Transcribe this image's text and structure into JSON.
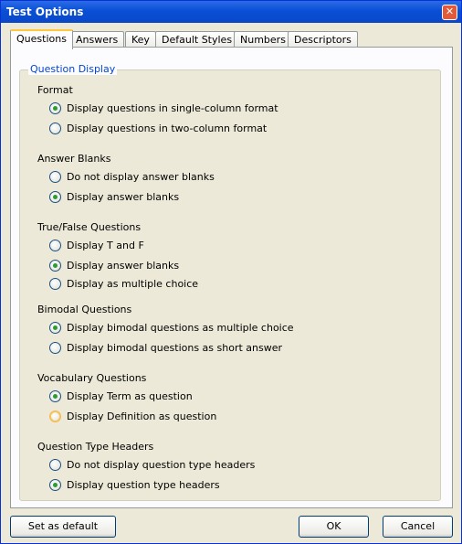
{
  "window": {
    "title": "Test Options",
    "close_glyph": "✕"
  },
  "tabs": [
    {
      "label": "Questions",
      "active": true
    },
    {
      "label": "Answers"
    },
    {
      "label": "Key"
    },
    {
      "label": "Default Styles"
    },
    {
      "label": "Numbers"
    },
    {
      "label": "Descriptors"
    }
  ],
  "group": {
    "legend": "Question Display",
    "sections": [
      {
        "label": "Format",
        "options": [
          {
            "label": "Display questions in single-column format",
            "checked": true
          },
          {
            "label": "Display questions in two-column format",
            "checked": false
          }
        ]
      },
      {
        "label": "Answer Blanks",
        "options": [
          {
            "label": "Do not display answer blanks",
            "checked": false
          },
          {
            "label": "Display answer blanks",
            "checked": true
          }
        ]
      },
      {
        "label": "True/False Questions",
        "options": [
          {
            "label": "Display T and F",
            "checked": false
          },
          {
            "label": "Display answer blanks",
            "checked": true
          },
          {
            "label": "Display as multiple choice",
            "checked": false
          }
        ]
      },
      {
        "label": "Bimodal Questions",
        "options": [
          {
            "label": "Display bimodal questions as multiple choice",
            "checked": true
          },
          {
            "label": "Display bimodal questions as short answer",
            "checked": false
          }
        ]
      },
      {
        "label": "Vocabulary Questions",
        "options": [
          {
            "label": "Display Term as question",
            "checked": true
          },
          {
            "label": "Display Definition as question",
            "checked": false
          }
        ]
      },
      {
        "label": "Question Type Headers",
        "options": [
          {
            "label": "Do not display question type headers",
            "checked": false
          },
          {
            "label": "Display question type headers",
            "checked": true
          }
        ]
      }
    ]
  },
  "buttons": {
    "set_default": "Set as default",
    "ok": "OK",
    "cancel": "Cancel"
  }
}
